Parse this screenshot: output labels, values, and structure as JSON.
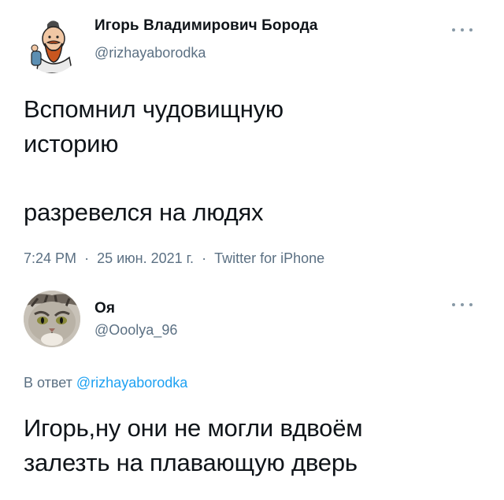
{
  "tweet_main": {
    "display_name": "Игорь Владимирович Борода",
    "handle": "@rizhayaborodka",
    "text_lines": [
      "Вспомнил чудовищную",
      "историю",
      "разревелся на людях"
    ],
    "time": "7:24 PM",
    "date": "25 июн. 2021 г.",
    "separator": "·",
    "source": "Twitter for iPhone",
    "more_icon": "more-horizontal-icon",
    "avatar_icon": "bearded-man-avatar"
  },
  "tweet_reply": {
    "display_name": "Оя",
    "handle": "@Ooolya_96",
    "reply_prefix": "В ответ",
    "reply_mention": "@rizhayaborodka",
    "text_lines": [
      "Игорь,ну они не могли вдвоём",
      "залезть на плавающую дверь"
    ],
    "more_icon": "more-horizontal-icon",
    "avatar_icon": "cat-avatar"
  },
  "colors": {
    "text": "#0f1419",
    "secondary": "#5b7083",
    "link": "#1da1f2"
  }
}
